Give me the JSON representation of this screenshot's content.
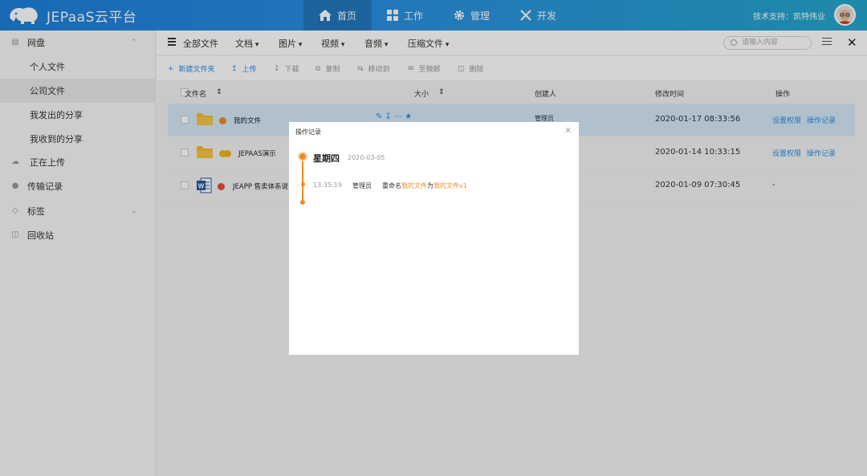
{
  "app": {
    "title": "JEPaaS云平台"
  },
  "nav": [
    {
      "label": "首页",
      "icon": "home-icon",
      "active": true
    },
    {
      "label": "工作",
      "icon": "grid-icon",
      "active": false
    },
    {
      "label": "管理",
      "icon": "gear-icon",
      "active": false
    },
    {
      "label": "开发",
      "icon": "tools-icon",
      "active": false
    }
  ],
  "header": {
    "tech_support": "技术支持：凯特伟业"
  },
  "sidebar": {
    "items": [
      {
        "label": "网盘",
        "icon": "disk-icon"
      },
      {
        "label": "个人文件"
      },
      {
        "label": "公司文件"
      },
      {
        "label": "我发出的分享"
      },
      {
        "label": "我收到的分享"
      },
      {
        "label": "正在上传",
        "icon": "upload-cloud-icon"
      },
      {
        "label": "传输记录",
        "icon": "transfer-icon"
      },
      {
        "label": "标签",
        "icon": "tag-icon"
      },
      {
        "label": "回收站",
        "icon": "trash-icon"
      }
    ]
  },
  "toolbar": {
    "all_files": "全部文件",
    "categories": [
      "文档",
      "图片",
      "视频",
      "音频",
      "压缩文件"
    ],
    "search_placeholder": "请输入内容"
  },
  "actions": [
    {
      "label": "新建文件夹",
      "enabled": true
    },
    {
      "label": "上传",
      "enabled": true
    },
    {
      "label": "下载",
      "enabled": false
    },
    {
      "label": "复制",
      "enabled": false
    },
    {
      "label": "移动到",
      "enabled": false
    },
    {
      "label": "至微邮",
      "enabled": false
    },
    {
      "label": "删除",
      "enabled": false
    }
  ],
  "table": {
    "columns": [
      "文件名",
      "大小",
      "创建人",
      "修改时间",
      "操作"
    ],
    "rows": [
      {
        "name": "我的文件",
        "type": "folder",
        "dot_color": "#f08c1e",
        "creator": "管理员",
        "modified": "2020-01-17 08:33:56",
        "op1": "设置权限",
        "op2": "操作记录"
      },
      {
        "name": "JEPAAS演示",
        "type": "folder",
        "dot_color": "#f0b41e",
        "creator": "",
        "modified": "2020-01-14 10:33:15",
        "op1": "设置权限",
        "op2": "操作记录"
      },
      {
        "name": "JEAPP 售卖体系说",
        "type": "word",
        "dot_color": "#e84c3d",
        "creator": "",
        "modified": "2020-01-09 07:30:45",
        "op1": "-",
        "op2": ""
      }
    ]
  },
  "modal": {
    "title": "操作记录",
    "day": "星期四",
    "date": "2020-03-05",
    "time": "13:35:19",
    "user": "管理员",
    "action_prefix": "重命名",
    "old_name": "我的文件",
    "connector": "为",
    "new_name": "我的文件v1"
  },
  "colors": {
    "accent": "#2b8be6",
    "orange": "#f08c1e",
    "header_start": "#1d7fd9",
    "header_end": "#24a7cc"
  }
}
